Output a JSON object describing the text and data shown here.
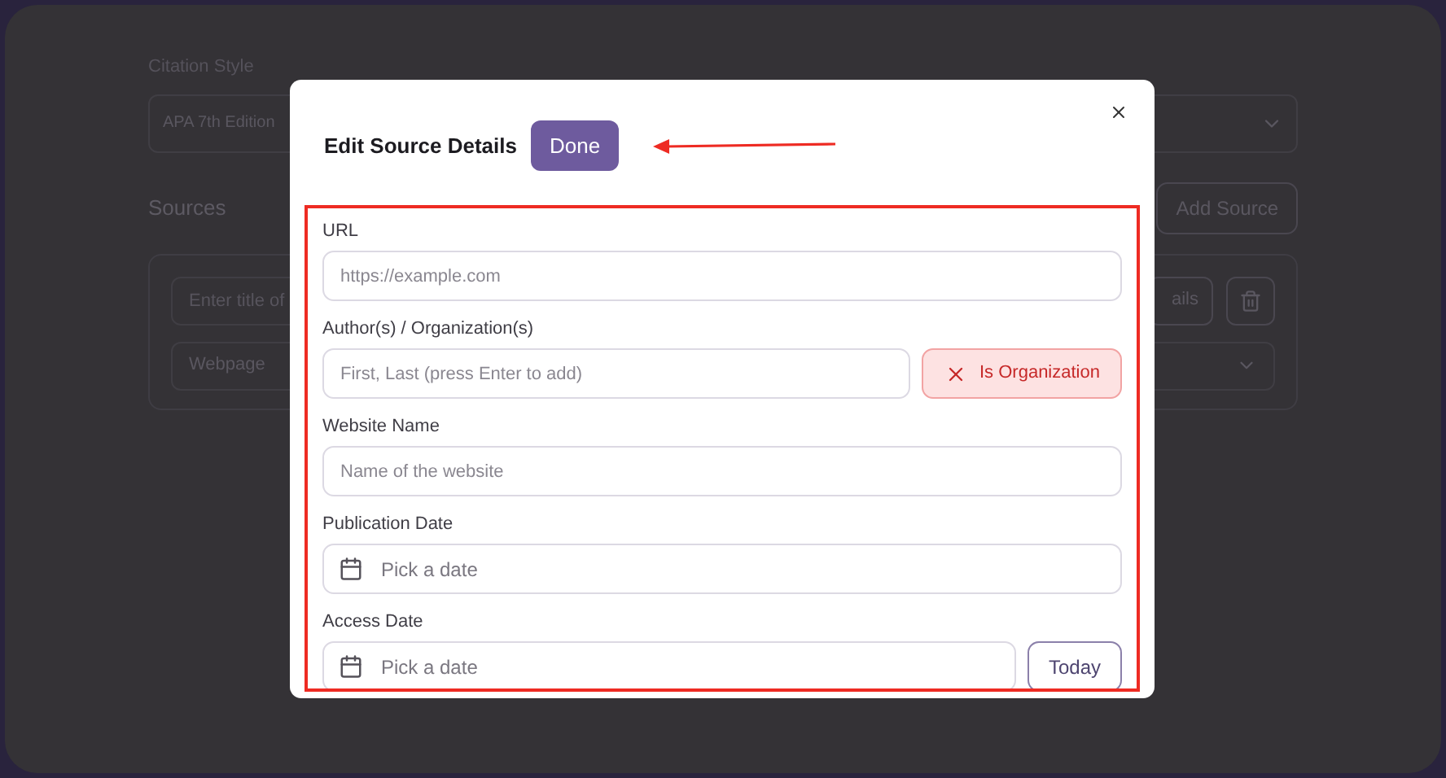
{
  "background": {
    "citation_style": {
      "label": "Citation Style",
      "value": "APA 7th Edition"
    },
    "sources": {
      "heading": "Sources",
      "add_button": "Add Source",
      "title_placeholder": "Enter title of",
      "details_button": "ails",
      "type_value": "Webpage"
    }
  },
  "dialog": {
    "title": "Edit Source Details",
    "done_button": "Done",
    "fields": [
      {
        "kind": "text",
        "label": "URL",
        "placeholder": "https://example.com"
      },
      {
        "kind": "author",
        "label": "Author(s) / Organization(s)",
        "placeholder": "First, Last (press Enter to add)",
        "toggle": {
          "label": "Is Organization",
          "on": false
        }
      },
      {
        "kind": "text",
        "label": "Website Name",
        "placeholder": "Name of the website"
      },
      {
        "kind": "date",
        "label": "Publication Date",
        "placeholder": "Pick a date"
      },
      {
        "kind": "date",
        "label": "Access Date",
        "placeholder": "Pick a date",
        "button": "Today"
      }
    ]
  }
}
